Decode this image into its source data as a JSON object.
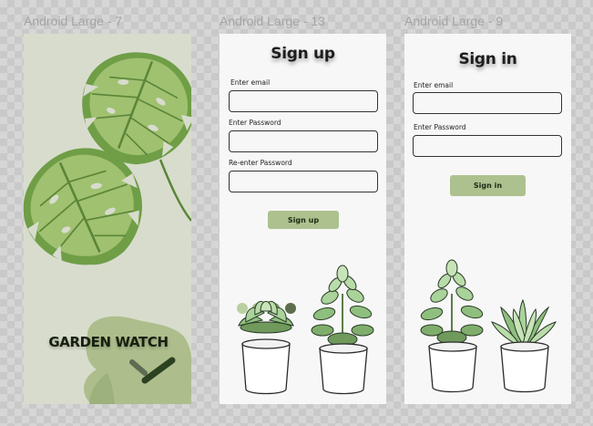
{
  "frames": {
    "splash": {
      "label": "Android Large - 7",
      "brand": "GARDEN WATCH"
    },
    "signup": {
      "label": "Android Large - 13",
      "title": "Sign up",
      "email_label": "Enter email",
      "password_label": "Enter Password",
      "reenter_label": "Re-enter Password",
      "button_label": "Sign up",
      "dots": [
        "#b9d19f",
        "#98b47a",
        "#7a9563",
        "#5c6e4d"
      ]
    },
    "signin": {
      "label": "Android Large - 9",
      "title": "Sign in",
      "email_label": "Enter email",
      "password_label": "Enter Password",
      "button_label": "Sign in"
    }
  },
  "colors": {
    "splash_bg": "#d8dccd",
    "leaf_green": "#6f9e46",
    "leaf_light": "#a7c77a",
    "blob": "#adbe8c",
    "button": "#adc18e",
    "pot": "#ffffff"
  },
  "icons": [
    "monstera-leaf-illustration",
    "succulent-plant-illustration",
    "toggle-logo-icon"
  ]
}
